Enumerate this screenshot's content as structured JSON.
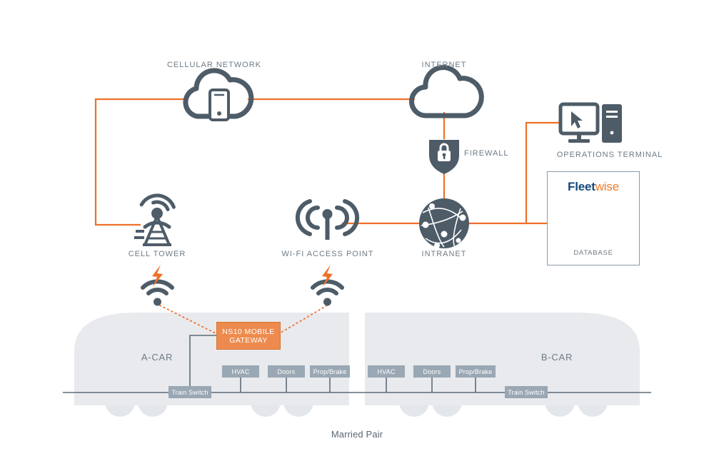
{
  "colors": {
    "accent_orange": "#ef7029",
    "icon_slate": "#4e5c68",
    "label_gray": "#6e7b86",
    "train_body": "#e8eaed",
    "sysbox_gray": "#9aa7b4",
    "gateway_orange": "#ed8b4e",
    "logo_navy": "#14487c",
    "logo_orange": "#ef7c28"
  },
  "nodes": {
    "cellular_network": {
      "label": "CELLULAR NETWORK",
      "icon": "cloud-with-phone-icon"
    },
    "internet": {
      "label": "INTERNET",
      "icon": "cloud-icon"
    },
    "firewall": {
      "label": "FIREWALL",
      "icon": "shield-lock-icon"
    },
    "operations_terminal": {
      "label": "OPERATIONS TERMINAL",
      "icon": "desktop-computer-icon"
    },
    "cell_tower": {
      "label": "CELL TOWER",
      "icon": "cell-tower-icon"
    },
    "wifi_access_point": {
      "label": "WI-FI ACCESS POINT",
      "icon": "wifi-antenna-icon"
    },
    "intranet": {
      "label": "INTRANET",
      "icon": "globe-network-icon"
    },
    "database": {
      "label": "DATABASE",
      "icon": "database-cylinder-icon",
      "logo_part1": "Fleet",
      "logo_part2": "wise"
    }
  },
  "gateway": {
    "line1": "NS10 MOBILE",
    "line2": "GATEWAY",
    "icon": "gateway-box"
  },
  "signals": {
    "a_car_antenna": {
      "icon": "wifi-signal-icon",
      "bolt": "lightning-bolt-icon"
    },
    "b_car_antenna": {
      "icon": "wifi-signal-icon",
      "bolt": "lightning-bolt-icon"
    }
  },
  "train": {
    "caption": "Married Pair",
    "cars": [
      {
        "name": "A-CAR",
        "switch_label": "Train Switch",
        "systems": [
          "HVAC",
          "Doors",
          "Prop/Brake"
        ]
      },
      {
        "name": "B-CAR",
        "switch_label": "Train Switch",
        "systems": [
          "HVAC",
          "Doors",
          "Prop/Brake"
        ]
      }
    ]
  }
}
